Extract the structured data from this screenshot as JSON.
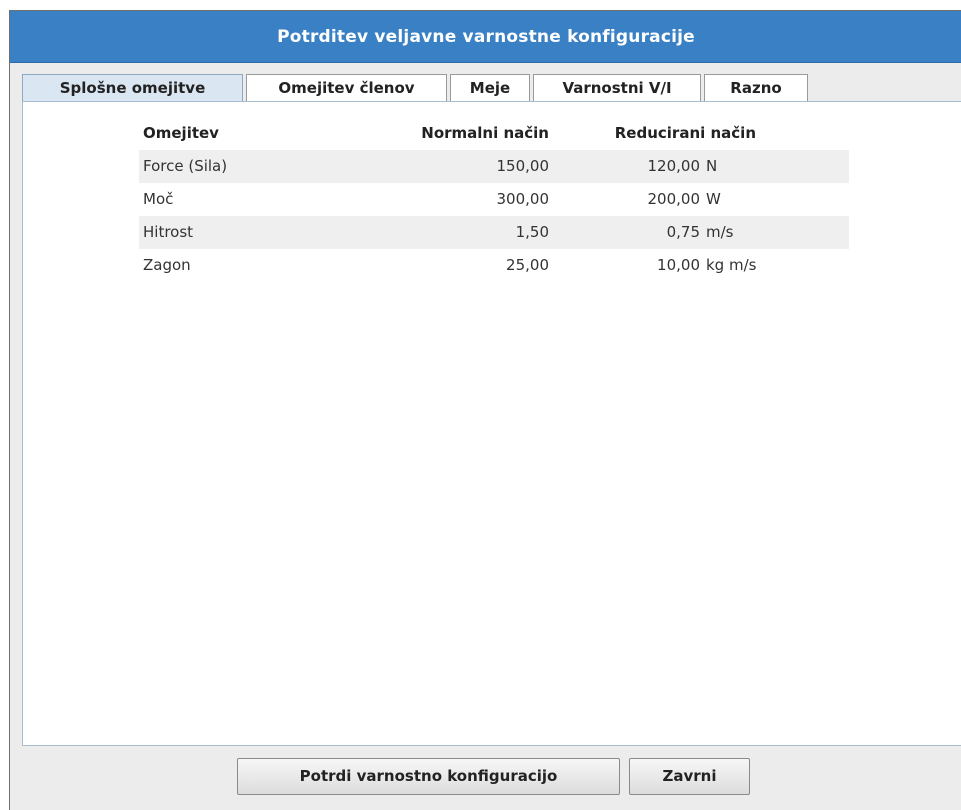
{
  "dialog": {
    "title": "Potrditev veljavne varnostne konfiguracije"
  },
  "tabs": [
    {
      "label": "Splošne omejitve",
      "active": true
    },
    {
      "label": "Omejitev členov",
      "active": false
    },
    {
      "label": "Meje",
      "active": false
    },
    {
      "label": "Varnostni V/I",
      "active": false
    },
    {
      "label": "Razno",
      "active": false
    }
  ],
  "table": {
    "headers": {
      "limit": "Omejitev",
      "normal": "Normalni način",
      "reduced": "Reducirani način"
    },
    "rows": [
      {
        "name": "Force (Sila)",
        "normal": "150,00",
        "reduced": "120,00",
        "unit": "N"
      },
      {
        "name": "Moč",
        "normal": "300,00",
        "reduced": "200,00",
        "unit": "W"
      },
      {
        "name": "Hitrost",
        "normal": "1,50",
        "reduced": "0,75",
        "unit": "m/s"
      },
      {
        "name": "Zagon",
        "normal": "25,00",
        "reduced": "10,00",
        "unit": "kg m/s"
      }
    ]
  },
  "buttons": {
    "confirm_label": "Potrdi varnostno konfiguracijo",
    "reject_label": "Zavrni"
  },
  "colors": {
    "title_bar": "#3a80c4",
    "active_tab": "#dbe6f3",
    "row_shade": "#efefef"
  }
}
